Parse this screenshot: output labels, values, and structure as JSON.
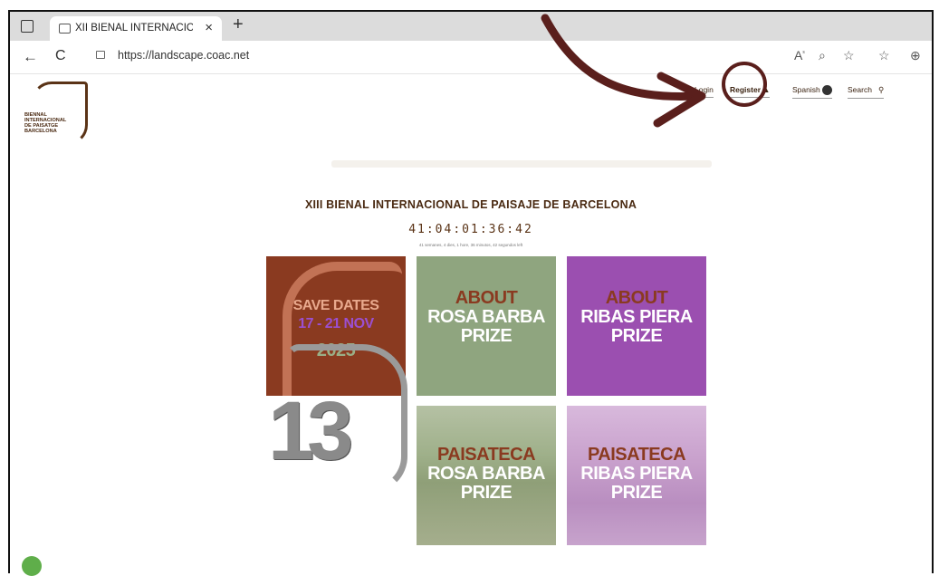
{
  "browser": {
    "tab_title": "XII BIENAL INTERNACIONAL DE PAISAJE",
    "tab_close": "×",
    "new_tab": "+",
    "url": "https://landscape.coac.net",
    "back": "←",
    "refresh": "C"
  },
  "site": {
    "logo_lines": [
      "BIENNAL",
      "INTERNACIONAL",
      "DE PAISATGE",
      "BARCELONA"
    ],
    "nav": {
      "login": "Login",
      "register": "Register",
      "language": "Spanish",
      "search": "Search"
    },
    "title": "XIII BIENAL INTERNACIONAL DE PAISAJE DE BARCELONA",
    "countdown": "41:04:01:36:42",
    "countdown_sub": "41 semanes, 4 dies, 1 hore, 36 minutos, 42 segundos left"
  },
  "tiles": [
    {
      "lines": [
        "SAVE DATES",
        "17 - 21 NOV",
        "2025"
      ],
      "colors": [
        "#e9a98d",
        "#9b4fd0",
        "#9aae86"
      ],
      "bg": "#8a3a20"
    },
    {
      "lines": [
        "ABOUT",
        "ROSA BARBA",
        "PRIZE"
      ],
      "colors": [
        "#8a3a20",
        "#ffffff",
        "#ffffff"
      ],
      "bg": "#8fa57f"
    },
    {
      "lines": [
        "ABOUT",
        "RIBAS PIERA",
        "PRIZE"
      ],
      "colors": [
        "#8a3a20",
        "#ffffff",
        "#ffffff"
      ],
      "bg": "#9b4fb0"
    },
    {
      "lines": [
        "13"
      ]
    },
    {
      "lines": [
        "PAISATECA",
        "ROSA BARBA",
        "PRIZE"
      ],
      "colors": [
        "#8a3a20",
        "#ffffff",
        "#ffffff"
      ]
    },
    {
      "lines": [
        "PAISATECA",
        "RIBAS PIERA",
        "PRIZE"
      ],
      "colors": [
        "#8a3a20",
        "#ffffff",
        "#ffffff"
      ]
    }
  ],
  "annotation": {
    "color": "#5a1f1c"
  }
}
